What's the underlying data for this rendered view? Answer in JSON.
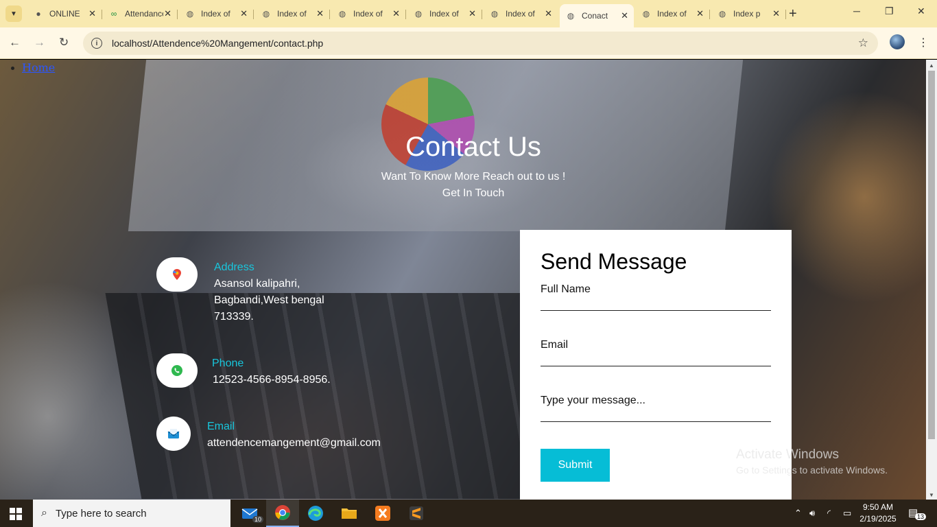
{
  "browser": {
    "tabs": [
      {
        "title": "ONLINE",
        "icon": "github-icon"
      },
      {
        "title": "Attendance",
        "icon": "infinity-icon"
      },
      {
        "title": "Index of",
        "icon": "globe-icon"
      },
      {
        "title": "Index of",
        "icon": "globe-icon"
      },
      {
        "title": "Index of",
        "icon": "globe-icon"
      },
      {
        "title": "Index of",
        "icon": "globe-icon"
      },
      {
        "title": "Index of",
        "icon": "globe-icon"
      },
      {
        "title": "Conact",
        "icon": "globe-icon"
      },
      {
        "title": "Index of",
        "icon": "globe-icon"
      },
      {
        "title": "Index p",
        "icon": "globe-icon"
      }
    ],
    "url": "localhost/Attendence%20Mangement/contact.php"
  },
  "page": {
    "home_link": "Home",
    "title": "Contact Us",
    "subtitle_1": "Want To Know More Reach out to us !",
    "subtitle_2": "Get In Touch",
    "address_label": "Address",
    "address_line_1": "Asansol kalipahri,",
    "address_line_2": "Bagbandi,West bengal",
    "address_line_3": "713339.",
    "phone_label": "Phone",
    "phone_value": "12523-4566-8954-8956.",
    "email_label": "Email",
    "email_value": "attendencemangement@gmail.com",
    "form": {
      "heading": "Send Message",
      "name_label": "Full Name",
      "email_label": "Email",
      "message_label": "Type your message...",
      "submit": "Submit"
    },
    "watermark_line_1": "Activate Windows",
    "watermark_line_2": "Go to Settings to activate Windows."
  },
  "taskbar": {
    "search_placeholder": "Type here to search",
    "mail_badge": "10",
    "time": "9:50 AM",
    "date": "2/19/2025",
    "notification_count": "13"
  },
  "colors": {
    "accent": "#06bdd6",
    "tabstrip": "#f8e9b0"
  }
}
